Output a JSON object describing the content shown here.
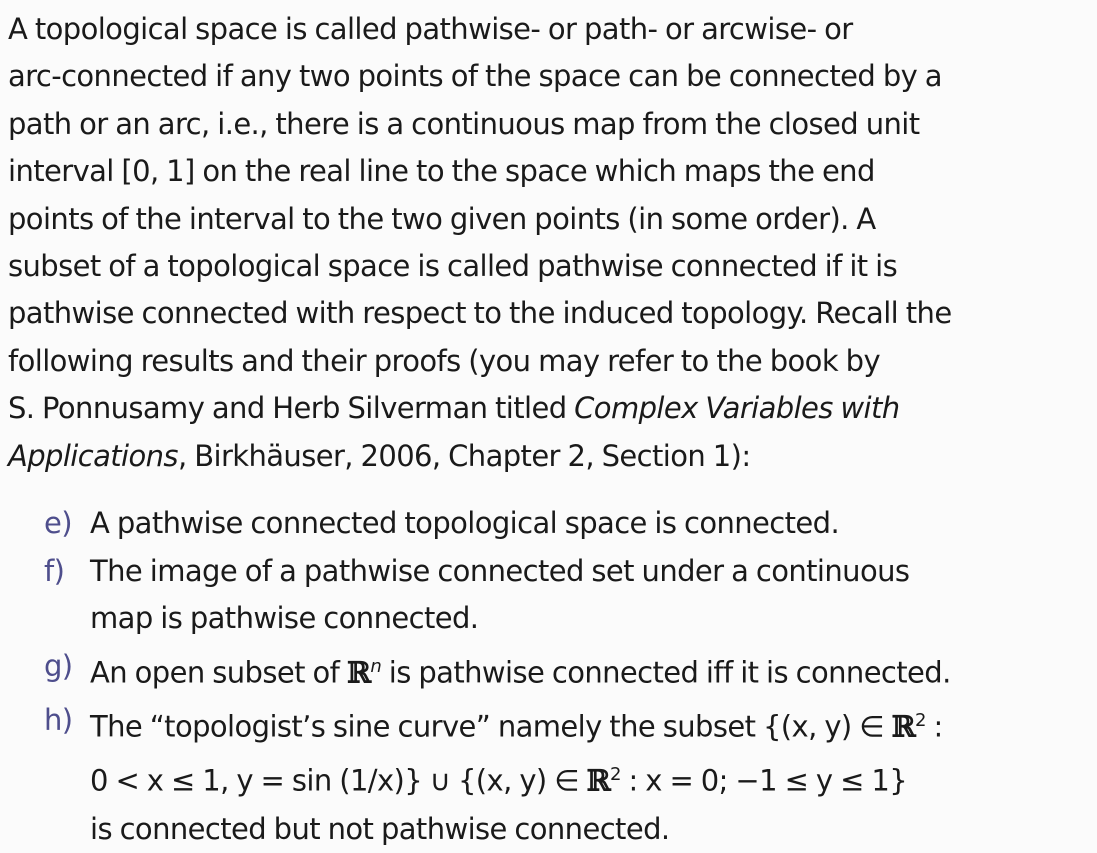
{
  "paragraph": {
    "lines": [
      "A topological space is called pathwise- or path- or arcwise- or",
      "arc-connected if any two points of the space can be connected by a",
      "path or an arc, i.e., there is a continuous map from the closed unit",
      "interval [0, 1] on the real line to the space which maps the end",
      "points of the interval to the two given points (in some order). A",
      "subset of a topological space is called pathwise connected if it is",
      "pathwise connected with respect to the induced topology. Recall the",
      "following results and their proofs (you may refer to the book by"
    ],
    "line9_start": "S. Ponnusamy and Herb Silverman titled ",
    "line9_italic": "Complex Variables with",
    "line10_italic": "Applications",
    "line10_end": ", Birkhäuser, 2006, Chapter 2, Section 1):"
  },
  "items": [
    {
      "label": "e)",
      "lines": [
        "A pathwise connected topological space is connected."
      ]
    },
    {
      "label": "f)",
      "lines": [
        "The image of a pathwise connected set under a continuous",
        "map is pathwise connected."
      ]
    },
    {
      "label": "g)",
      "pre": "An open subset of ",
      "bb": "ℝ",
      "sup": "n",
      "post": " is pathwise connected iff it is connected."
    },
    {
      "label": "h)",
      "line1_pre": "The “topologist’s sine curve” namely the subset {(x, y) ∈ ",
      "line1_bb": "ℝ",
      "line1_sup": "2",
      "line1_post": " :",
      "line2_a": "0 < x ≤ 1, y = sin (1/x)} ∪ {(x, y) ∈ ",
      "line2_bb": "ℝ",
      "line2_sup": "2",
      "line2_b": " : x = 0; −1 ≤ y ≤ 1}",
      "line3": "is connected but not pathwise connected."
    }
  ]
}
